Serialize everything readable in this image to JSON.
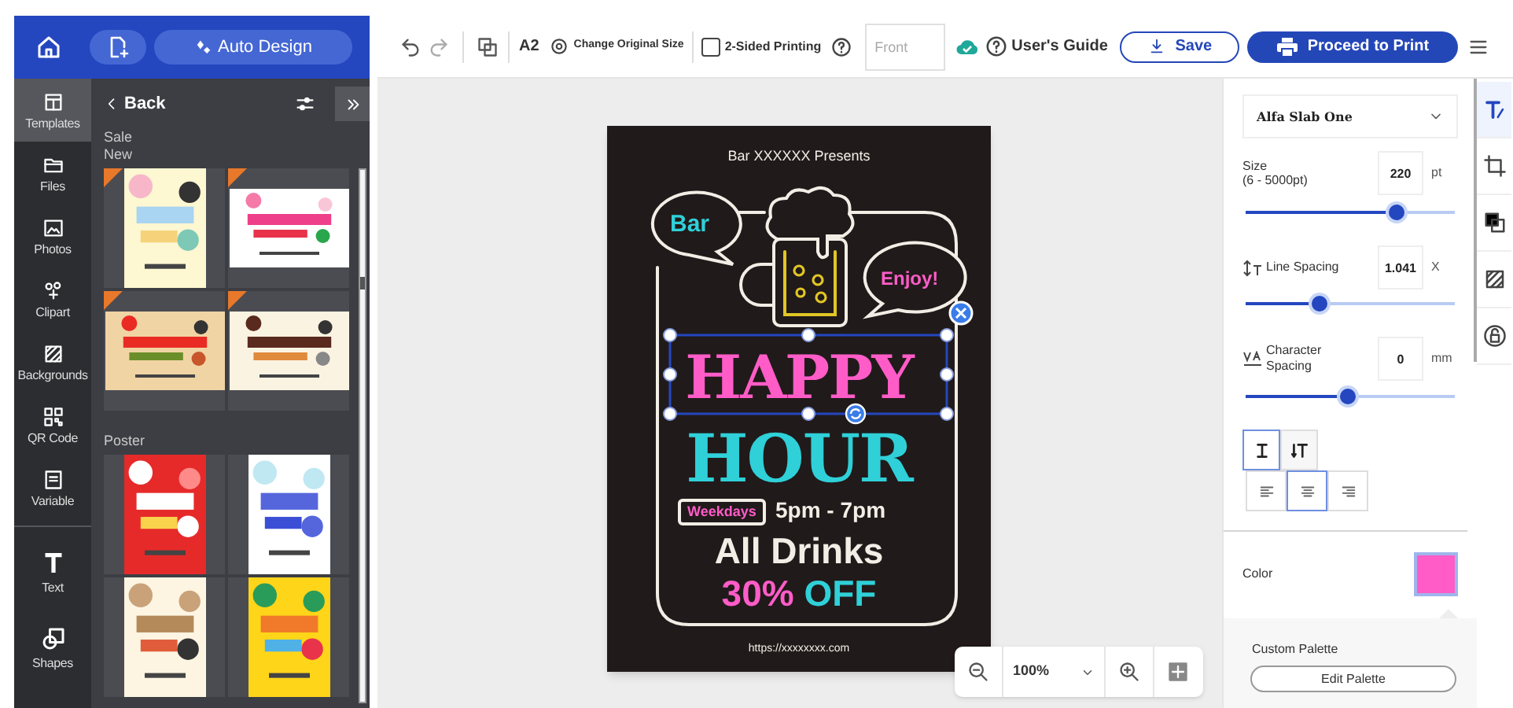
{
  "header": {
    "auto_design": "Auto Design"
  },
  "rail": [
    {
      "label": "Templates",
      "selected": true
    },
    {
      "label": "Files",
      "selected": false
    },
    {
      "label": "Photos",
      "selected": false
    },
    {
      "label": "Clipart",
      "selected": false
    },
    {
      "label": "Backgrounds",
      "selected": false
    },
    {
      "label": "QR Code",
      "selected": false
    },
    {
      "label": "Variable",
      "selected": false
    },
    {
      "label": "Text",
      "selected": false
    },
    {
      "label": "Shapes",
      "selected": false
    }
  ],
  "template_panel": {
    "back": "Back",
    "groups": [
      {
        "title": "Sale",
        "subtitle": "New",
        "templates": [
          {
            "kind": "picture",
            "new": true
          },
          {
            "kind": "picture",
            "new": true
          },
          {
            "kind": "picture",
            "new": true
          },
          {
            "kind": "picture",
            "new": true
          }
        ]
      },
      {
        "title": "Poster",
        "templates": [
          {
            "kind": "picture"
          },
          {
            "kind": "picture"
          },
          {
            "kind": "picture"
          },
          {
            "kind": "picture"
          }
        ]
      }
    ]
  },
  "toolbar": {
    "paper_size": "A2",
    "change_size": "Change Original Size",
    "two_sided": {
      "label": "2-Sided Printing",
      "checked": false
    },
    "side_field": {
      "placeholder": "Front"
    },
    "guide": "User's Guide",
    "save": "Save",
    "print": "Proceed to Print"
  },
  "poster": {
    "presents": "Bar XXXXXX Presents",
    "bubble_left": "Bar",
    "bubble_right": "Enjoy!",
    "line1": "HAPPY",
    "line2": "HOUR",
    "tag": "Weekdays",
    "time": "5pm - 7pm",
    "drinks": "All Drinks",
    "discount_number": "30%",
    "discount_word": "OFF",
    "url": "https://xxxxxxxx.com"
  },
  "zoom": {
    "value": "100%"
  },
  "text_panel": {
    "font": "Alfa Slab One",
    "size": {
      "label": "Size",
      "range": "(6 - 5000pt)",
      "value": "220",
      "unit": "pt",
      "level": 0.72
    },
    "line_spacing": {
      "label": "Line Spacing",
      "value": "1.041",
      "unit": "X",
      "level": 0.35
    },
    "character_spacing": {
      "label": "Character Spacing",
      "value": "0",
      "unit": "mm",
      "level": 0.49
    },
    "direction": [
      {
        "kind": "horizontal",
        "selected": true
      },
      {
        "kind": "vertical",
        "selected": false
      }
    ],
    "alignment": [
      {
        "kind": "left",
        "selected": false
      },
      {
        "kind": "center",
        "selected": true
      },
      {
        "kind": "right",
        "selected": false
      }
    ],
    "color": {
      "label": "Color",
      "color": "#ff5cc8"
    },
    "palette": {
      "title": "Custom Palette",
      "button": "Edit Palette"
    }
  },
  "side_tools": [
    {
      "kind": "text",
      "selected": true
    },
    {
      "kind": "crop",
      "selected": false
    },
    {
      "kind": "layers",
      "selected": false
    },
    {
      "kind": "pattern",
      "selected": false
    },
    {
      "kind": "lock",
      "selected": false
    }
  ]
}
